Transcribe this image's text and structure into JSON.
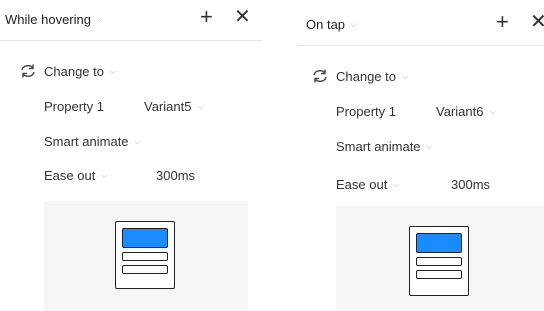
{
  "panel_a": {
    "trigger": "While hovering",
    "action": "Change to",
    "property_label": "Property 1",
    "property_value": "Variant5",
    "animation": "Smart animate",
    "easing": "Ease out",
    "duration": "300ms"
  },
  "panel_b": {
    "trigger": "On tap",
    "action": "Change to",
    "property_label": "Property 1",
    "property_value": "Variant6",
    "animation": "Smart animate",
    "easing": "Ease out",
    "duration": "300ms"
  },
  "icons": {
    "add": "+",
    "close": "✕",
    "chevron": "⌵",
    "action": "refresh-arrows"
  },
  "colors": {
    "accent": "#1a8cff",
    "preview_bg": "#f5f5f5"
  }
}
